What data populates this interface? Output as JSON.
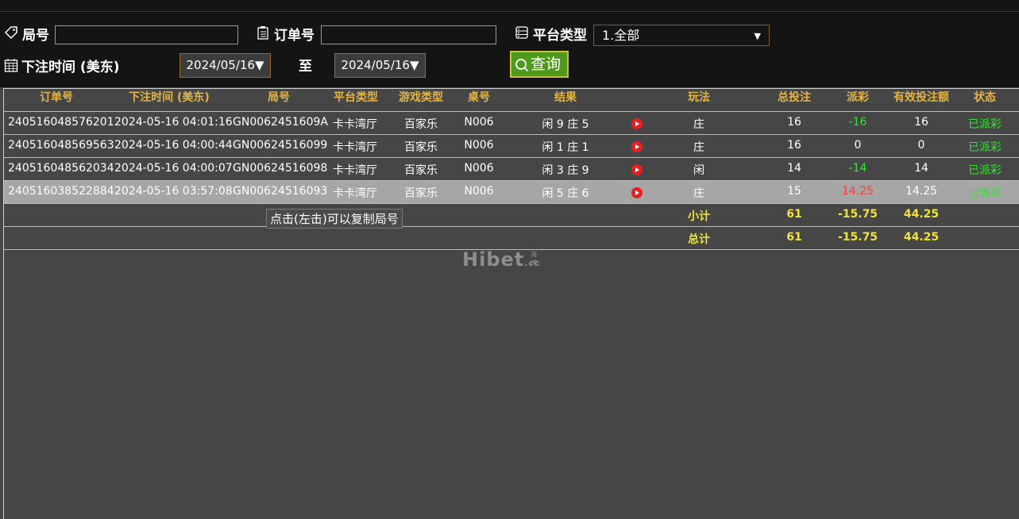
{
  "filters": {
    "round_label": "局号",
    "round_value": "",
    "order_label": "订单号",
    "order_value": "",
    "platform_label": "平台类型",
    "platform_selected": "1.全部",
    "bet_time_label": "下注时间 (美东)",
    "date_from": "2024/05/16▼",
    "to_label": "至",
    "date_to": "2024/05/16▼",
    "query_label": "查询"
  },
  "table": {
    "headers": [
      "订单号",
      "下注时间 (美东)",
      "局号",
      "平台类型",
      "游戏类型",
      "桌号",
      "结果",
      "玩法",
      "总投注",
      "派彩",
      "有效投注额",
      "状态"
    ],
    "rows": [
      {
        "order": "240516048576201",
        "time": "2024-05-16 04:01:16",
        "round": "GN0062451609A",
        "platform": "卡卡湾厅",
        "game": "百家乐",
        "table": "N006",
        "result": "闲 9 庄 5",
        "play": "庄",
        "bet": "16",
        "payout": "-16",
        "valid": "16",
        "status": "已派彩"
      },
      {
        "order": "240516048569563",
        "time": "2024-05-16 04:00:44",
        "round": "GN00624516099",
        "platform": "卡卡湾厅",
        "game": "百家乐",
        "table": "N006",
        "result": "闲 1 庄 1",
        "play": "庄",
        "bet": "16",
        "payout": "0",
        "valid": "0",
        "status": "已派彩"
      },
      {
        "order": "240516048562034",
        "time": "2024-05-16 04:00:07",
        "round": "GN00624516098",
        "platform": "卡卡湾厅",
        "game": "百家乐",
        "table": "N006",
        "result": "闲 3 庄 9",
        "play": "闲",
        "bet": "14",
        "payout": "-14",
        "valid": "14",
        "status": "已派彩"
      },
      {
        "order": "240516038522884",
        "time": "2024-05-16 03:57:08",
        "round": "GN00624516093",
        "platform": "卡卡湾厅",
        "game": "百家乐",
        "table": "N006",
        "result": "闲 5 庄 6",
        "play": "庄",
        "bet": "15",
        "payout": "14.25",
        "valid": "14.25",
        "status": "已派彩"
      }
    ],
    "subtotal": {
      "label": "小计",
      "bet": "61",
      "payout": "-15.75",
      "valid": "44.25"
    },
    "total": {
      "label": "总计",
      "bet": "61",
      "payout": "-15.75",
      "valid": "44.25"
    }
  },
  "tooltip": "点击(左击)可以复制局号",
  "watermark": {
    "main": "Hibet",
    "sub": ".cc",
    "cn": "海博"
  },
  "colors": {
    "header": "#e6b441",
    "positive": "#2ee82e",
    "negative_payout": "#ff3c3c",
    "summary": "#f0e23a",
    "selected_row": "#a6a6a6"
  }
}
